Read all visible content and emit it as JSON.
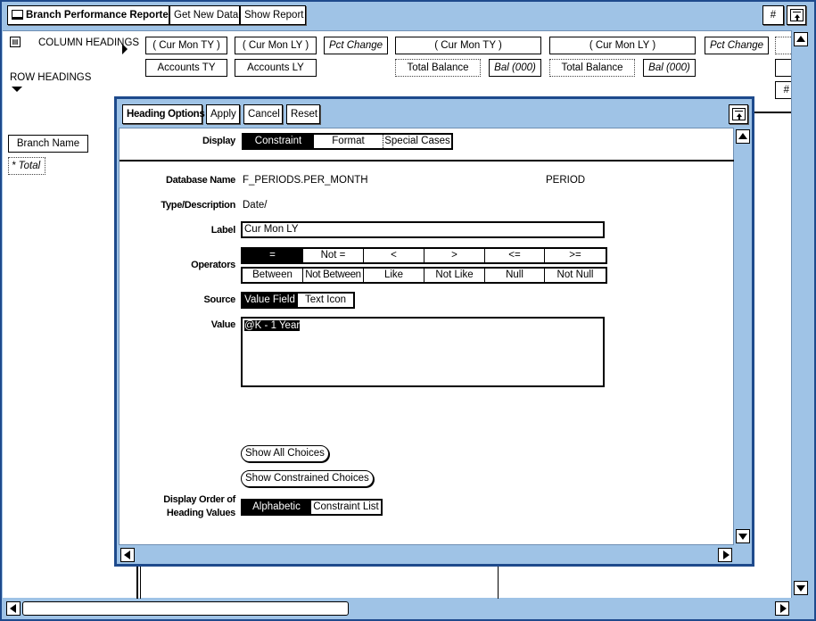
{
  "toolbar": {
    "app_title": "Branch Performance Reporter",
    "get_new_data": "Get New Data",
    "show_report": "Show Report",
    "hash": "#"
  },
  "report": {
    "column_headings": "COLUMN HEADINGS",
    "row_headings": "ROW HEADINGS",
    "columns_row1": [
      "( Cur Mon TY )",
      "( Cur Mon LY )",
      "Pct Change",
      "( Cur Mon TY )",
      "( Cur Mon LY )",
      "Pct Change"
    ],
    "columns_row2": [
      "Accounts TY",
      "Accounts LY",
      "Total Balance",
      "Bal (000)",
      "Total Balance",
      "Bal (000)"
    ],
    "right_hash": "#",
    "rows": [
      "Branch Name",
      "* Total"
    ]
  },
  "dialog": {
    "toolbar": {
      "heading_options": "Heading Options",
      "apply": "Apply",
      "cancel": "Cancel",
      "reset": "Reset"
    },
    "display": {
      "label": "Display",
      "options": [
        "Constraint",
        "Format",
        "Special Cases"
      ],
      "selected": "Constraint"
    },
    "database_name": {
      "label": "Database Name",
      "value": "F_PERIODS.PER_MONTH",
      "extra": "PERIOD"
    },
    "type_description": {
      "label": "Type/Description",
      "value": "Date/"
    },
    "label_field": {
      "label": "Label",
      "value": "Cur Mon LY"
    },
    "operators": {
      "label": "Operators",
      "row1": [
        "=",
        "Not =",
        "<",
        ">",
        "<=",
        ">="
      ],
      "row2": [
        "Between",
        "Not Between",
        "Like",
        "Not Like",
        "Null",
        "Not Null"
      ],
      "selected": "="
    },
    "source": {
      "label": "Source",
      "options": [
        "Value Field",
        "Text Icon"
      ],
      "selected": "Value Field"
    },
    "value": {
      "label": "Value",
      "text": "@K - 1 Year"
    },
    "show_all_choices": "Show All Choices",
    "show_constrained_choices": "Show Constrained Choices",
    "display_order": {
      "label_line1": "Display Order of",
      "label_line2": "Heading Values",
      "options": [
        "Alphabetic",
        "Constraint List"
      ],
      "selected": "Alphabetic"
    }
  },
  "colors": {
    "frame_blue": "#1e4a8c",
    "chrome_blue": "#9fc3e6"
  }
}
